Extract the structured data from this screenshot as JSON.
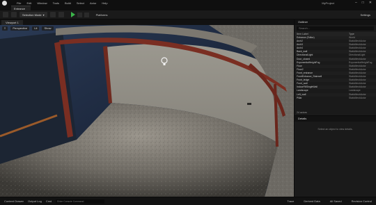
{
  "menu": [
    "File",
    "Edit",
    "Window",
    "Tools",
    "Build",
    "Select",
    "Actor",
    "Help"
  ],
  "project_name": "MyProject",
  "level_tab": "Entrance",
  "toolbar": {
    "mode": "Selection Mode",
    "platforms": "Platforms",
    "settings": "Settings"
  },
  "viewport": {
    "tab": "Viewport 1",
    "perspective": "Perspective",
    "lit": "Lit",
    "show": "Show"
  },
  "outliner": {
    "tab": "Outliner",
    "search_placeholder": "Search...",
    "columns": [
      "Item Label",
      "Type"
    ],
    "rows": [
      {
        "name": "Entrance (Editor)",
        "type": "World"
      },
      {
        "name": "Arch2",
        "type": "StaticMeshActor"
      },
      {
        "name": "Arch3",
        "type": "StaticMeshActor"
      },
      {
        "name": "Arch4",
        "type": "StaticMeshActor"
      },
      {
        "name": "Back_wall",
        "type": "StaticMeshActor"
      },
      {
        "name": "DirectionalLight",
        "type": "DirectionalLight"
      },
      {
        "name": "Door_closed",
        "type": "StaticMeshActor"
      },
      {
        "name": "ExponentialHeightFog",
        "type": "ExponentialHeightFog"
      },
      {
        "name": "Floor",
        "type": "StaticMeshActor"
      },
      {
        "name": "Floor2",
        "type": "StaticMeshActor"
      },
      {
        "name": "Front_entrance",
        "type": "StaticMeshActor"
      },
      {
        "name": "FrontEntrance_Stairwell",
        "type": "StaticMeshActor"
      },
      {
        "name": "Front_ledge",
        "type": "StaticMeshActor"
      },
      {
        "name": "Front_wall",
        "type": "StaticMeshActor"
      },
      {
        "name": "IndoorFillSingleWall",
        "type": "StaticMeshActor"
      },
      {
        "name": "Landscape",
        "type": "Landscape"
      },
      {
        "name": "Left_wall",
        "type": "StaticMeshActor"
      },
      {
        "name": "Pillar",
        "type": "StaticMeshActor"
      }
    ],
    "actor_count": "24 actors"
  },
  "details": {
    "tab": "Details",
    "empty_msg": "Select an object to view details."
  },
  "statusbar": {
    "content_drawer": "Content Drawer",
    "output_log": "Output Log",
    "cmd": "Cmd",
    "cmd_placeholder": "Enter Console Command",
    "trace": "Trace",
    "derived_data": "Derived Data",
    "all_saved": "All Saved",
    "revision_control": "Revision Control"
  },
  "colors": {
    "accent_play": "#3bb54a",
    "steel_beam": "#7a2e22"
  }
}
